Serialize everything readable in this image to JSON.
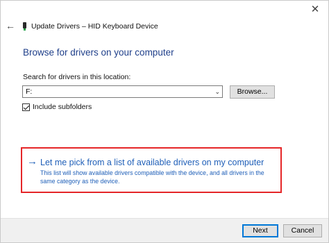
{
  "window": {
    "close_glyph": "✕",
    "back_glyph": "←",
    "title": "Update Drivers – HID Keyboard Device",
    "device_icon": "usb-keyboard-device-icon"
  },
  "main": {
    "heading": "Browse for drivers on your computer",
    "search_label": "Search for drivers in this location:",
    "path_value": "F:",
    "browse_label": "Browse...",
    "include_subfolders_label": "Include subfolders",
    "include_subfolders_checked": true
  },
  "pick_option": {
    "arrow": "→",
    "title": "Let me pick from a list of available drivers on my computer",
    "description": "This list will show available drivers compatible with the device, and all drivers in the same category as the device.",
    "highlight_color": "#e52628",
    "link_color": "#1f5fb8"
  },
  "footer": {
    "next_label": "Next",
    "cancel_label": "Cancel"
  }
}
